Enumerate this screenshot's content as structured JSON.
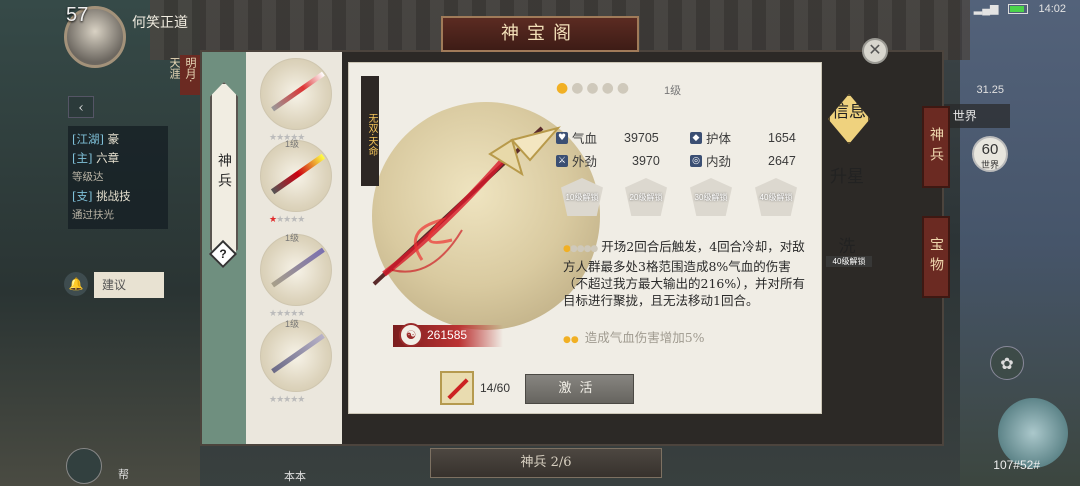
{
  "hud": {
    "level": "57",
    "player_name": "何笑正道",
    "side_button": "明月·天涯",
    "back": "‹",
    "quests": [
      {
        "tag": "[江湖]",
        "text": "豪"
      },
      {
        "tag": "[主]",
        "text": "六章"
      },
      {
        "tag": "",
        "text": "等级达"
      },
      {
        "tag": "[支]",
        "text": "挑战技"
      },
      {
        "tag": "",
        "text": "通过扶光"
      }
    ],
    "suggest": "建议",
    "time": "14:02",
    "ping": "31.25",
    "world_button": "世界",
    "world_count": "60",
    "world_count_label": "世界",
    "coords": "107#52#",
    "bottom_text_1": "帮",
    "bottom_text_2": "本本"
  },
  "modal": {
    "title": "神宝阁",
    "close": "✕",
    "left_tab": "神兵",
    "help": "?",
    "weapon_name": "无双·天命",
    "power": "261585",
    "star_level": "1级",
    "stars": {
      "filled": 1,
      "total": 5
    },
    "stats": [
      {
        "label": "气血",
        "value": "39705",
        "icon": "heart-icon"
      },
      {
        "label": "护体",
        "value": "1654",
        "icon": "shield-icon"
      },
      {
        "label": "外劲",
        "value": "3970",
        "icon": "sword-icon"
      },
      {
        "label": "内劲",
        "value": "2647",
        "icon": "swirl-icon"
      }
    ],
    "locked_slots": [
      "10级解锁",
      "20级解锁",
      "30级解锁",
      "40级解锁"
    ],
    "skill_text": "开场2回合后触发，4回合冷却，对敌方人群最多处3格范围造成8%气血的伤害（不超过我方最大输出的216%），并对所有目标进行聚拢，且无法移动1回合。",
    "skill2_text": "造成气血伤害增加5%",
    "fragment_count": "14/60",
    "activate": "激活",
    "right_tabs": {
      "info": "信息",
      "star_up": "升星",
      "refine": "洗",
      "refine_lock": "40级解锁"
    },
    "side_tabs": [
      "神兵",
      "宝物"
    ],
    "page": "神兵 2/6",
    "list": [
      {
        "level": "",
        "stars_on": 0
      },
      {
        "level": "1级",
        "stars_on": 1
      },
      {
        "level": "1级",
        "stars_on": 0
      },
      {
        "level": "1级",
        "stars_on": 0
      }
    ]
  },
  "colors": {
    "accent_gold": "#f1b024",
    "red": "#c22a2a",
    "tab_green": "#6f8f7f"
  }
}
